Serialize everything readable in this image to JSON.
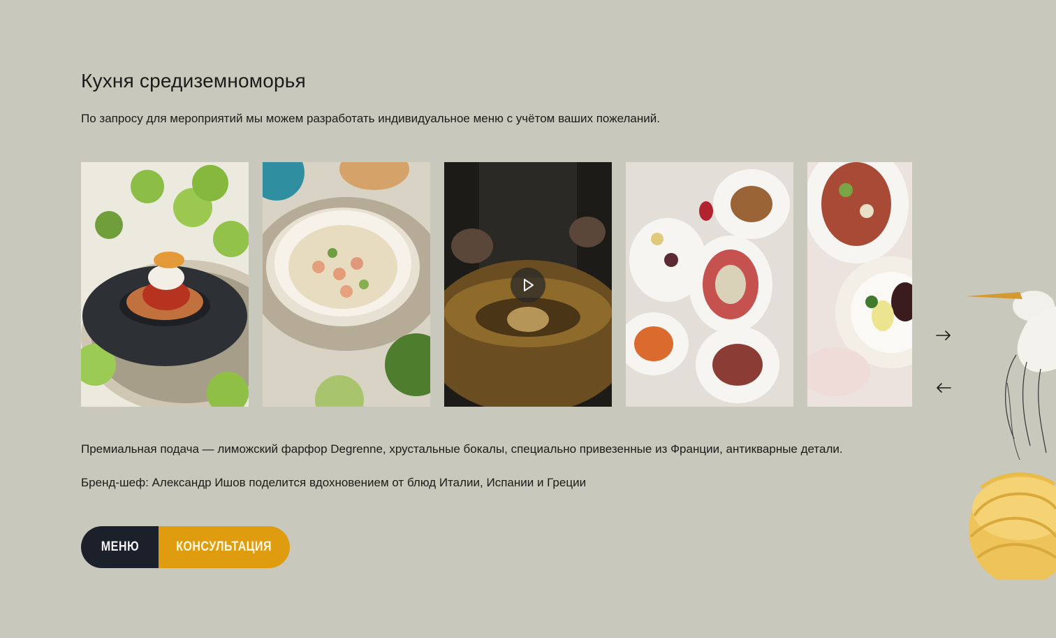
{
  "section": {
    "title": "Кухня средиземноморья",
    "intro": "По запросу для мероприятий мы можем разработать индивидуальное меню с учётом ваших пожеланий."
  },
  "gallery": {
    "photos": [
      {
        "subject": "dessert-in-stone-bowl"
      },
      {
        "subject": "cream-soup-with-shrimp"
      },
      {
        "subject": "pasta-in-cheese-wheel-video"
      },
      {
        "subject": "table-with-several-dishes"
      },
      {
        "subject": "salad-and-plated-dishes"
      }
    ],
    "play_icon": "play-icon",
    "next_icon": "arrow-right-icon",
    "prev_icon": "arrow-left-icon"
  },
  "details": {
    "service": "Премиальная подача — лиможский фарфор Degrenne, хрустальные бокалы, специально привезенные из Франции, антикварные детали.",
    "chef": "Бренд-шеф: Александр Ишов поделится вдохновением от блюд Италии, Испании и Греции"
  },
  "buttons": {
    "menu_label": "МЕНЮ",
    "consult_label": "КОНСУЛЬТАЦИЯ"
  },
  "colors": {
    "background": "#c8c8bc",
    "menu_button": "#1b202b",
    "consult_button": "#e09c0f"
  }
}
